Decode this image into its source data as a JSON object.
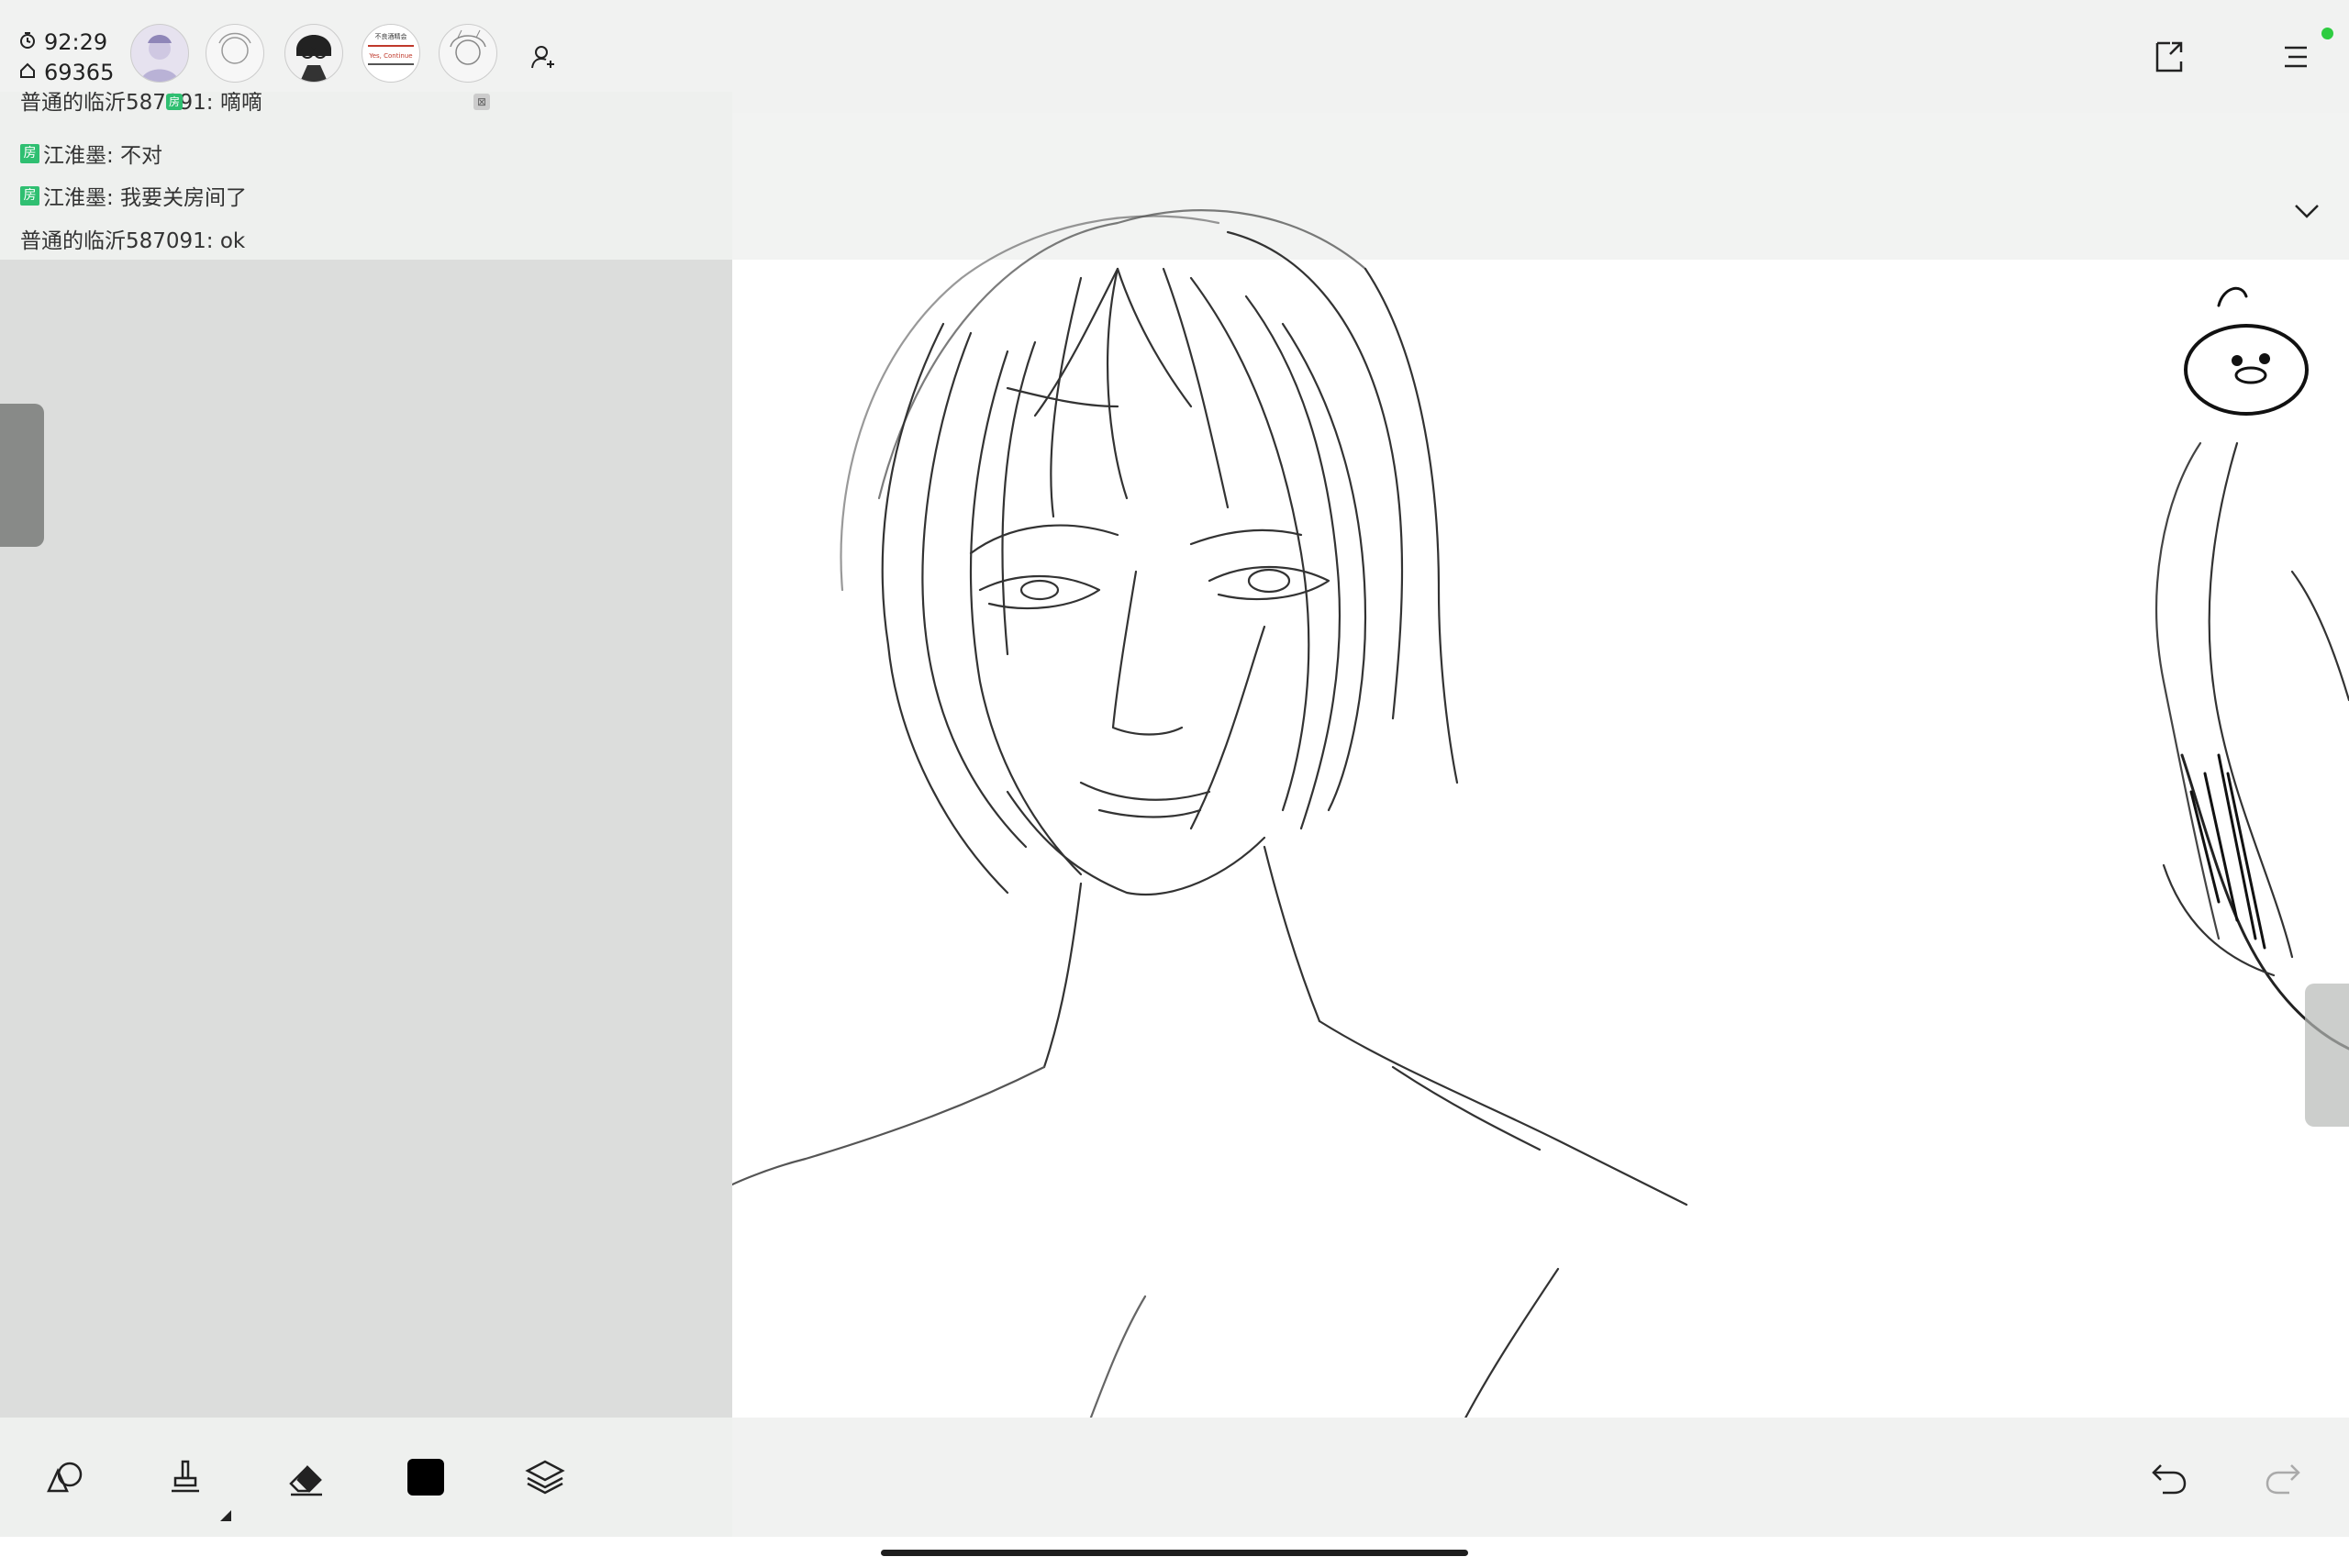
{
  "stats": {
    "timer": "92:29",
    "home_count": "69365"
  },
  "avatars": [
    {
      "name": "avatar-1",
      "badge": "房"
    },
    {
      "name": "avatar-2"
    },
    {
      "name": "avatar-3"
    },
    {
      "name": "avatar-4",
      "text_top": "不良酒精会",
      "text_bottom": "Yes, Continue"
    },
    {
      "name": "avatar-5",
      "badge": "⊠"
    }
  ],
  "chat": [
    {
      "tag": "",
      "text": "普通的临沂587091:  嘀嘀"
    },
    {
      "tag": "房",
      "text": "江淮墨:  不对"
    },
    {
      "tag": "房",
      "text": "江淮墨:  我要关房间了"
    },
    {
      "tag": "",
      "text": "普通的临沂587091:  ok"
    }
  ],
  "icons": {
    "add_user": "add-user-icon",
    "share": "share-icon",
    "menu": "menu-icon",
    "collapse": "chevron-down-icon",
    "shape": "shape-tool-icon",
    "brush": "brush-tool-icon",
    "eraser": "eraser-icon",
    "color": "color-swatch-icon",
    "layers": "layers-icon",
    "undo": "undo-icon",
    "redo": "redo-icon"
  },
  "colors": {
    "current_color": "#000000",
    "online": "#2ecc40",
    "room_tag": "#2fbf71"
  }
}
